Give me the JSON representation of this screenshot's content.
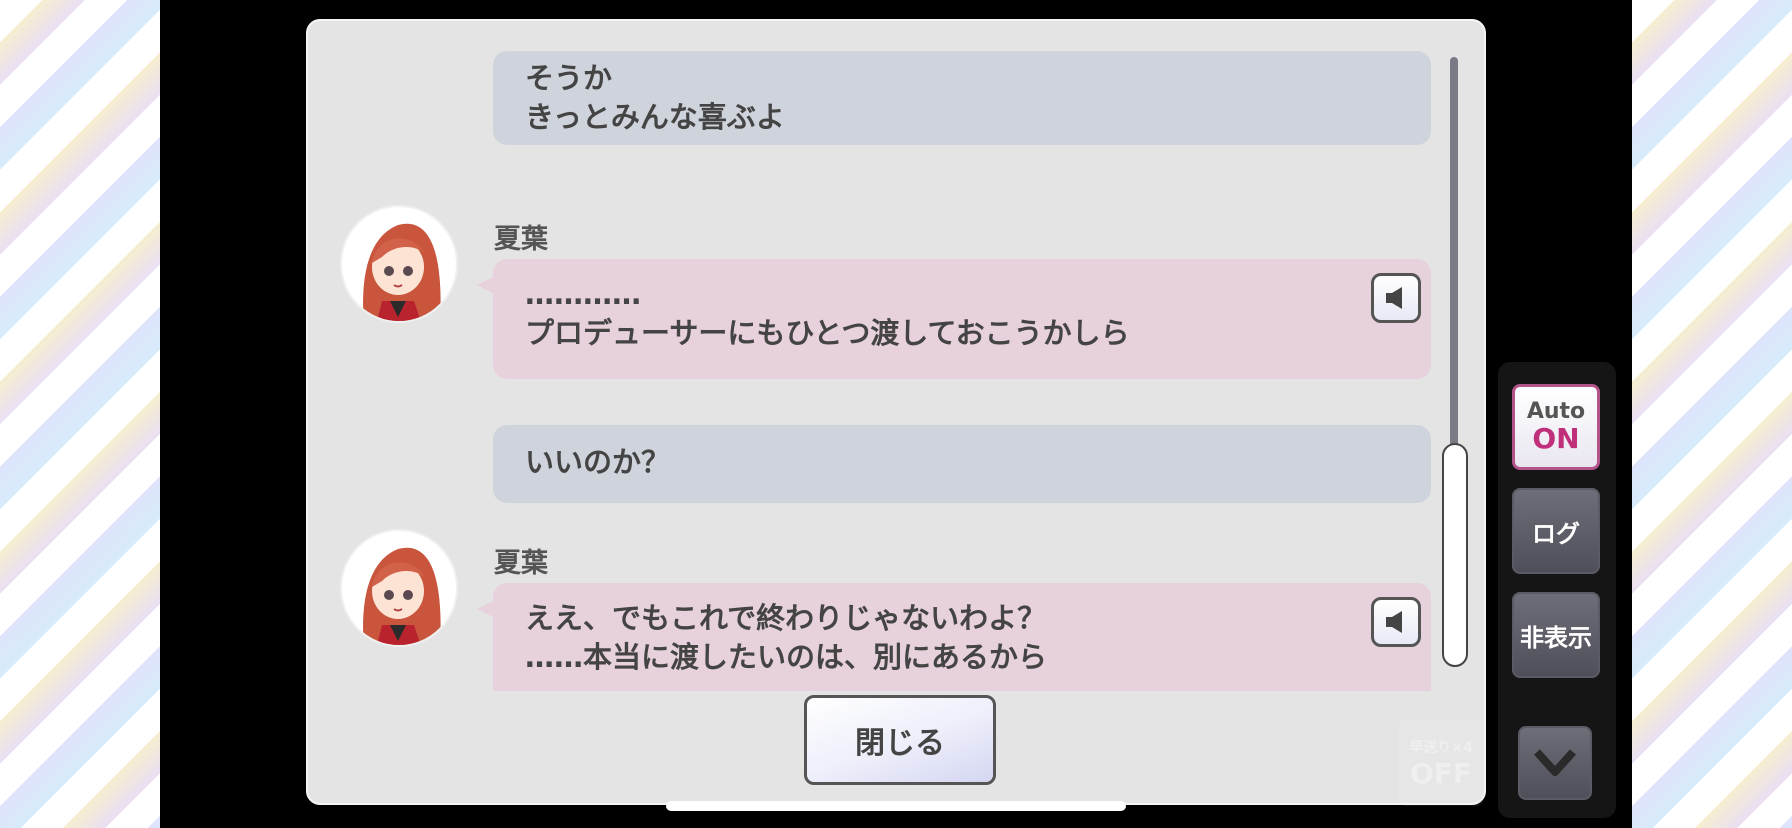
{
  "messages": [
    {
      "lines": [
        "そうか",
        "きっとみんな喜ぶよ"
      ]
    },
    {
      "speaker": "夏葉",
      "lines": [
        "…………",
        "プロデューサーにもひとつ渡しておこうかしら"
      ]
    },
    {
      "lines": [
        "いいのか？"
      ]
    },
    {
      "speaker": "夏葉",
      "lines": [
        "ええ、でもこれで終わりじゃないわよ？",
        "……本当に渡したいのは、別にあるから"
      ]
    }
  ],
  "close_label": "閉じる",
  "controls": {
    "auto_label": "Auto",
    "auto_state": "ON",
    "log_label": "ログ",
    "hide_label": "非表示",
    "fast_forward_label": "早送り×4",
    "fast_forward_state": "OFF"
  },
  "colors": {
    "panel_bg": "#e4e4e4",
    "player_bubble": "#cfd4dc",
    "character_bubble": "#e7d1dc",
    "auto_accent": "#c0307a"
  },
  "icons": {
    "voice": "speaker-icon",
    "collapse": "chevron-down-icon"
  }
}
